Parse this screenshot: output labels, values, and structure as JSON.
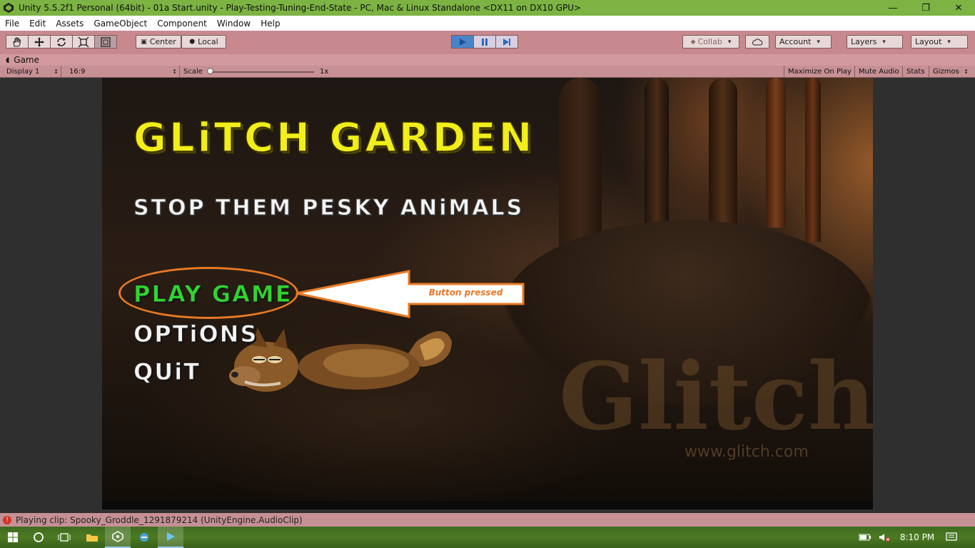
{
  "window": {
    "title": "Unity 5.5.2f1 Personal (64bit) - 01a Start.unity - Play-Testing-Tuning-End-State - PC, Mac & Linux Standalone <DX11 on DX10 GPU>",
    "minimize": "—",
    "restore": "❐",
    "close": "✕"
  },
  "menu": {
    "items": [
      "File",
      "Edit",
      "Assets",
      "GameObject",
      "Component",
      "Window",
      "Help"
    ]
  },
  "toolbar": {
    "tools": [
      "hand-icon",
      "move-icon",
      "rotate-icon",
      "scale-icon",
      "rect-icon"
    ],
    "pivot_label": "Center",
    "space_label": "Local",
    "collab_label": "Collab",
    "account_label": "Account",
    "layers_label": "Layers",
    "layout_label": "Layout"
  },
  "game_tab": {
    "title": "Game"
  },
  "game_bar": {
    "display": "Display 1",
    "aspect": "16:9",
    "scale_label": "Scale",
    "scale_value": "1x",
    "maximize": "Maximize On Play",
    "mute": "Mute Audio",
    "stats": "Stats",
    "gizmos": "Gizmos"
  },
  "game": {
    "title": "GLiTCH GARDEN",
    "subtitle": "STOP THEM PESKY ANiMALS",
    "play": "PLAY GAME",
    "options": "OPTiONS",
    "quit": "QUiT",
    "watermark": "Glitch",
    "watermark_url": "www.glitch.com"
  },
  "annotation": {
    "label": "Button pressed",
    "color": "#e8782a"
  },
  "status": {
    "message": "Playing clip: Spooky_Groddle_1291879214 (UnityEngine.AudioClip)"
  },
  "taskbar": {
    "time": "8:10 PM"
  },
  "colors": {
    "title_yellow": "#f1ee1a",
    "play_green": "#2fd62f",
    "editor_tint": "#c8898e",
    "play_blue": "#4a84c8"
  }
}
